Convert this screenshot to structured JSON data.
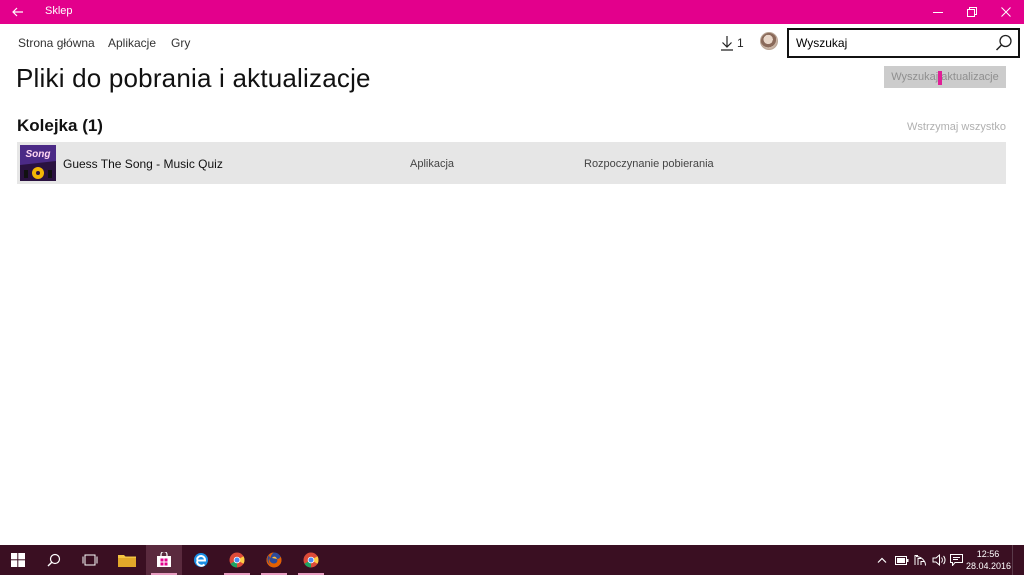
{
  "window": {
    "title": "Sklep"
  },
  "colors": {
    "accent": "#e3008c",
    "taskbar": "#3a0f22",
    "row_bg": "#e6e6e6"
  },
  "nav": {
    "items": [
      {
        "label": "Strona główna"
      },
      {
        "label": "Aplikacje"
      },
      {
        "label": "Gry"
      }
    ],
    "downloads_count": "1",
    "search": {
      "placeholder": "Wyszukaj"
    }
  },
  "page": {
    "title": "Pliki do pobrania i aktualizacje",
    "check_updates_label": "Wyszukaj aktualizacje"
  },
  "queue": {
    "title": "Kolejka (1)",
    "pause_all_label": "Wstrzymaj wszystko",
    "items": [
      {
        "name": "Guess The Song - Music Quiz",
        "type": "Aplikacja",
        "status": "Rozpoczynanie pobierania",
        "thumb_text": "Song"
      }
    ]
  },
  "taskbar": {
    "apps": [
      "windows-start-icon",
      "search-icon",
      "task-view-icon",
      "file-explorer-icon",
      "store-icon",
      "edge-icon",
      "chrome-icon",
      "firefox-icon",
      "chrome-icon"
    ],
    "clock": {
      "time": "12:56",
      "date": "28.04.2016"
    }
  }
}
